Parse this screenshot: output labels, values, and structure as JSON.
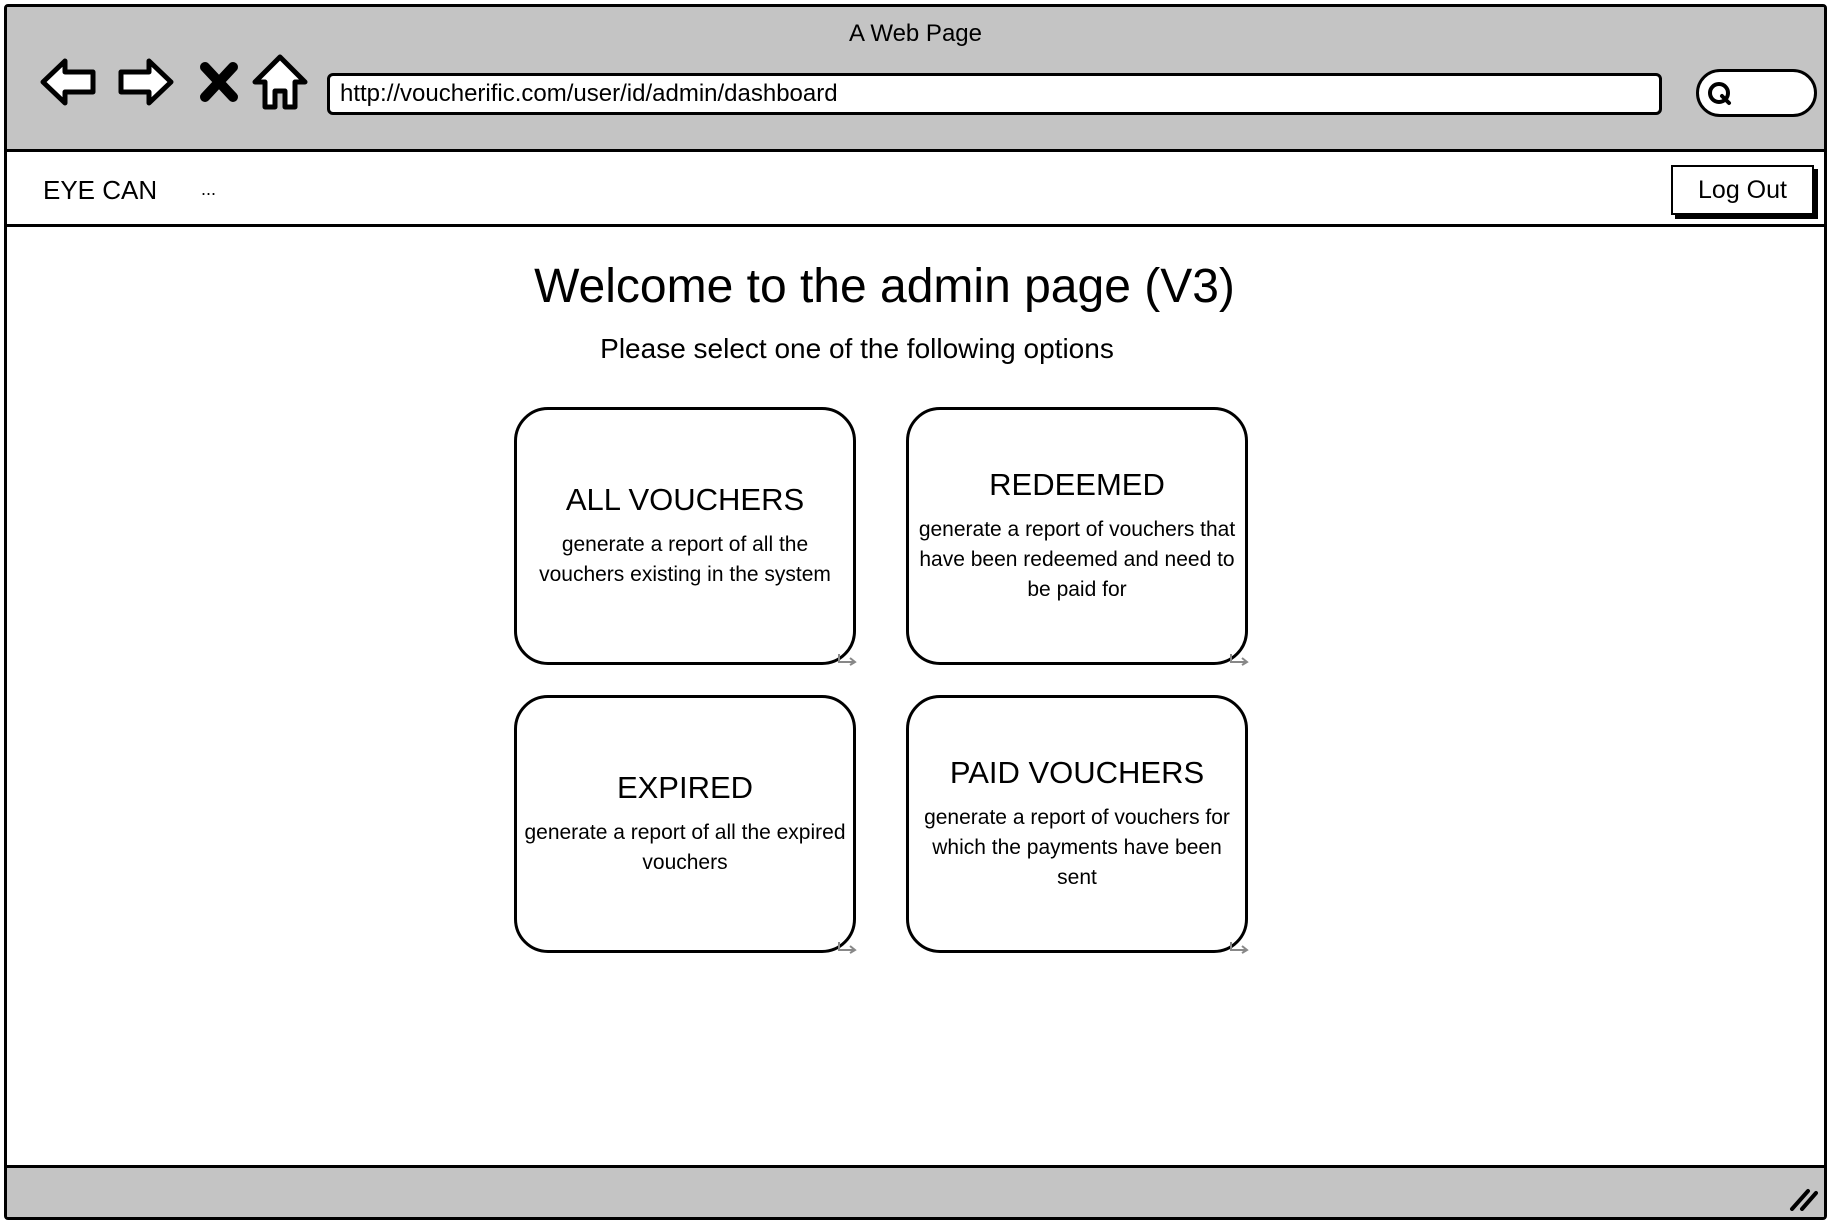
{
  "browser": {
    "window_title": "A Web Page",
    "url": "http://voucherific.com/user/id/admin/dashboard",
    "nav_icons": [
      "back-arrow-icon",
      "forward-arrow-icon",
      "stop-x-icon",
      "home-icon"
    ],
    "search_icon": "magnifier-icon"
  },
  "header": {
    "brand": "EYE CAN",
    "ellipsis": "...",
    "logout_label": "Log Out"
  },
  "main": {
    "title": "Welcome to the admin page (V3)",
    "subtitle": "Please select one of the following options",
    "cards": [
      {
        "title": "ALL VOUCHERS",
        "description": "generate a report of all the vouchers existing in the system"
      },
      {
        "title": "REDEEMED",
        "description": "generate a report of vouchers that have been redeemed and need to be paid for"
      },
      {
        "title": "EXPIRED",
        "description": "generate a report of all the expired vouchers"
      },
      {
        "title": "PAID VOUCHERS",
        "description": "generate a report of vouchers for which the payments have been sent"
      }
    ]
  },
  "colors": {
    "chrome_gray": "#c4c4c4",
    "ink": "#000000",
    "paper": "#ffffff"
  }
}
